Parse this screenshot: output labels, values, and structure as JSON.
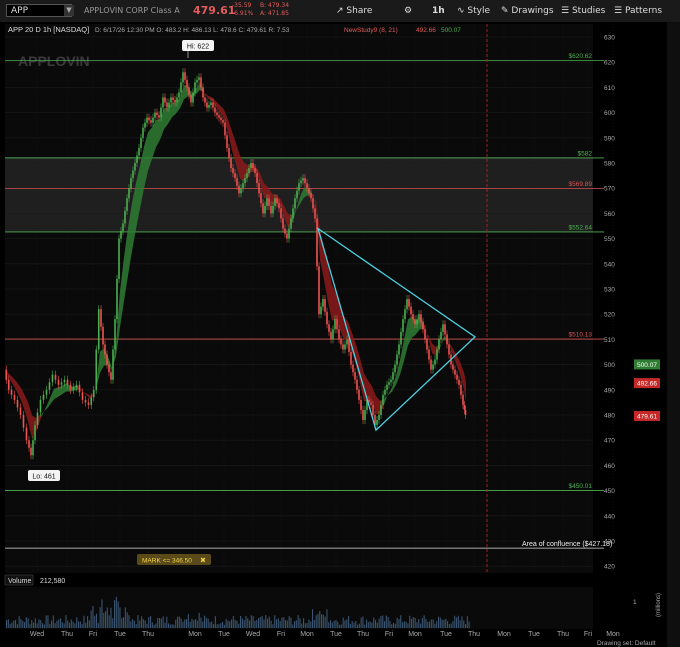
{
  "header": {
    "symbol": "APP",
    "company": "APPLOVIN CORP Class A",
    "last": "479.61",
    "change": "-35.59",
    "change_pct": "-6.91%",
    "bid": "B: 479.34",
    "ask": "A: 471.85",
    "buttons": {
      "share": "Share",
      "timeframe": "1h",
      "style": "Style",
      "drawings": "Drawings",
      "studies": "Studies",
      "patterns": "Patterns"
    }
  },
  "chart_info": {
    "title": "APP 20 D 1h [NASDAQ]",
    "ohlc": "D: 6/17/26 12:30 PM   O: 483.2   H: 486.13   L: 478.6   C: 479.61   R: 7.53",
    "study": "NewStudy9 (8, 21)",
    "study_v1": "492.66",
    "study_v2": "500.07"
  },
  "watermark": "APPLOVIN",
  "labels": {
    "hi": "Hi: 622",
    "lo": "Lo: 461",
    "confluence": "Area of confluence ($427.18)",
    "mark": "MARK <= 346.50",
    "volume": "Volume",
    "volume_value": "212,580",
    "volume_unit": "(millions)",
    "drawing_set": "Drawing set: Default"
  },
  "levels": [
    {
      "price": 620.62,
      "label": "$620.62",
      "color": "#4caf50"
    },
    {
      "price": 582,
      "label": "$582",
      "color": "#4caf50"
    },
    {
      "price": 569.89,
      "label": "$569.89",
      "color": "#d65454"
    },
    {
      "price": 552.64,
      "label": "$552.64",
      "color": "#4caf50"
    },
    {
      "price": 510.13,
      "label": "$510.13",
      "color": "#d65454"
    },
    {
      "price": 450.01,
      "label": "$450.01",
      "color": "#4caf50"
    },
    {
      "price": 427.18,
      "label": "",
      "color": "#dddddd"
    }
  ],
  "price_badges": [
    {
      "price": 500.07,
      "text": "500.07",
      "bg": "#2f7d32"
    },
    {
      "price": 492.66,
      "text": "492.66",
      "bg": "#c62828"
    },
    {
      "price": 479.61,
      "text": "479.61",
      "bg": "#c62828"
    }
  ],
  "y_ticks": [
    630,
    620,
    610,
    600,
    590,
    580,
    570,
    560,
    550,
    540,
    530,
    520,
    510,
    500,
    490,
    480,
    470,
    460,
    450,
    440,
    430,
    420
  ],
  "x_ticks": [
    {
      "label": "Wed",
      "x": 37
    },
    {
      "label": "Thu",
      "x": 67
    },
    {
      "label": "Fri",
      "x": 93
    },
    {
      "label": "Tue",
      "x": 120
    },
    {
      "label": "Thu",
      "x": 148
    },
    {
      "label": "Mon",
      "x": 195
    },
    {
      "label": "Tue",
      "x": 224
    },
    {
      "label": "Wed",
      "x": 253
    },
    {
      "label": "Fri",
      "x": 281
    },
    {
      "label": "Mon",
      "x": 307
    },
    {
      "label": "Tue",
      "x": 336
    },
    {
      "label": "Thu",
      "x": 363
    },
    {
      "label": "Fri",
      "x": 389
    },
    {
      "label": "Mon",
      "x": 415
    },
    {
      "label": "Tue",
      "x": 446
    },
    {
      "label": "Thu",
      "x": 474
    },
    {
      "label": "Mon",
      "x": 504
    },
    {
      "label": "Tue",
      "x": 534
    },
    {
      "label": "Thu",
      "x": 563
    },
    {
      "label": "Fri",
      "x": 588
    },
    {
      "label": "Mon",
      "x": 613
    }
  ],
  "colors": {
    "up": "#4caf50",
    "down": "#ef5350",
    "band_up": "#2e7d32",
    "band_down": "#8b1a1a",
    "triangle": "#4dd0e1"
  },
  "chart_data": {
    "type": "candlestick",
    "xlabel": "",
    "ylabel": "",
    "ylim": [
      420,
      630
    ],
    "triangle": [
      [
        318,
        554
      ],
      [
        376,
        474
      ],
      [
        475,
        511
      ]
    ],
    "price_path": [
      [
        5,
        498
      ],
      [
        10,
        490
      ],
      [
        16,
        486
      ],
      [
        22,
        480
      ],
      [
        28,
        470
      ],
      [
        32,
        464
      ],
      [
        36,
        476
      ],
      [
        42,
        486
      ],
      [
        48,
        490
      ],
      [
        54,
        496
      ],
      [
        60,
        492
      ],
      [
        66,
        494
      ],
      [
        72,
        490
      ],
      [
        78,
        492
      ],
      [
        84,
        486
      ],
      [
        90,
        484
      ],
      [
        95,
        490
      ],
      [
        100,
        522
      ],
      [
        104,
        508
      ],
      [
        108,
        500
      ],
      [
        112,
        494
      ],
      [
        116,
        518
      ],
      [
        120,
        550
      ],
      [
        124,
        556
      ],
      [
        128,
        566
      ],
      [
        132,
        574
      ],
      [
        136,
        580
      ],
      [
        140,
        586
      ],
      [
        144,
        594
      ],
      [
        148,
        598
      ],
      [
        152,
        596
      ],
      [
        156,
        600
      ],
      [
        160,
        598
      ],
      [
        164,
        606
      ],
      [
        168,
        602
      ],
      [
        172,
        606
      ],
      [
        176,
        604
      ],
      [
        180,
        608
      ],
      [
        184,
        616
      ],
      [
        188,
        610
      ],
      [
        192,
        604
      ],
      [
        196,
        612
      ],
      [
        200,
        614
      ],
      [
        204,
        606
      ],
      [
        208,
        602
      ],
      [
        212,
        604
      ],
      [
        216,
        600
      ],
      [
        220,
        598
      ],
      [
        224,
        596
      ],
      [
        228,
        586
      ],
      [
        232,
        578
      ],
      [
        236,
        574
      ],
      [
        240,
        568
      ],
      [
        244,
        572
      ],
      [
        248,
        576
      ],
      [
        252,
        580
      ],
      [
        256,
        576
      ],
      [
        260,
        568
      ],
      [
        264,
        560
      ],
      [
        268,
        566
      ],
      [
        272,
        560
      ],
      [
        276,
        566
      ],
      [
        280,
        562
      ],
      [
        284,
        554
      ],
      [
        288,
        550
      ],
      [
        292,
        558
      ],
      [
        296,
        566
      ],
      [
        300,
        572
      ],
      [
        304,
        574
      ],
      [
        308,
        570
      ],
      [
        312,
        566
      ],
      [
        316,
        558
      ],
      [
        320,
        520
      ],
      [
        324,
        526
      ],
      [
        328,
        516
      ],
      [
        332,
        510
      ],
      [
        336,
        518
      ],
      [
        340,
        510
      ],
      [
        344,
        506
      ],
      [
        348,
        510
      ],
      [
        352,
        500
      ],
      [
        356,
        494
      ],
      [
        360,
        486
      ],
      [
        364,
        478
      ],
      [
        368,
        486
      ],
      [
        372,
        484
      ],
      [
        376,
        476
      ],
      [
        380,
        480
      ],
      [
        384,
        488
      ],
      [
        388,
        492
      ],
      [
        392,
        494
      ],
      [
        396,
        500
      ],
      [
        400,
        508
      ],
      [
        404,
        518
      ],
      [
        408,
        526
      ],
      [
        412,
        520
      ],
      [
        416,
        516
      ],
      [
        420,
        520
      ],
      [
        424,
        514
      ],
      [
        428,
        506
      ],
      [
        432,
        498
      ],
      [
        436,
        502
      ],
      [
        440,
        510
      ],
      [
        444,
        516
      ],
      [
        448,
        508
      ],
      [
        452,
        500
      ],
      [
        456,
        496
      ],
      [
        460,
        492
      ],
      [
        464,
        484
      ],
      [
        466,
        480
      ]
    ],
    "volume": []
  }
}
